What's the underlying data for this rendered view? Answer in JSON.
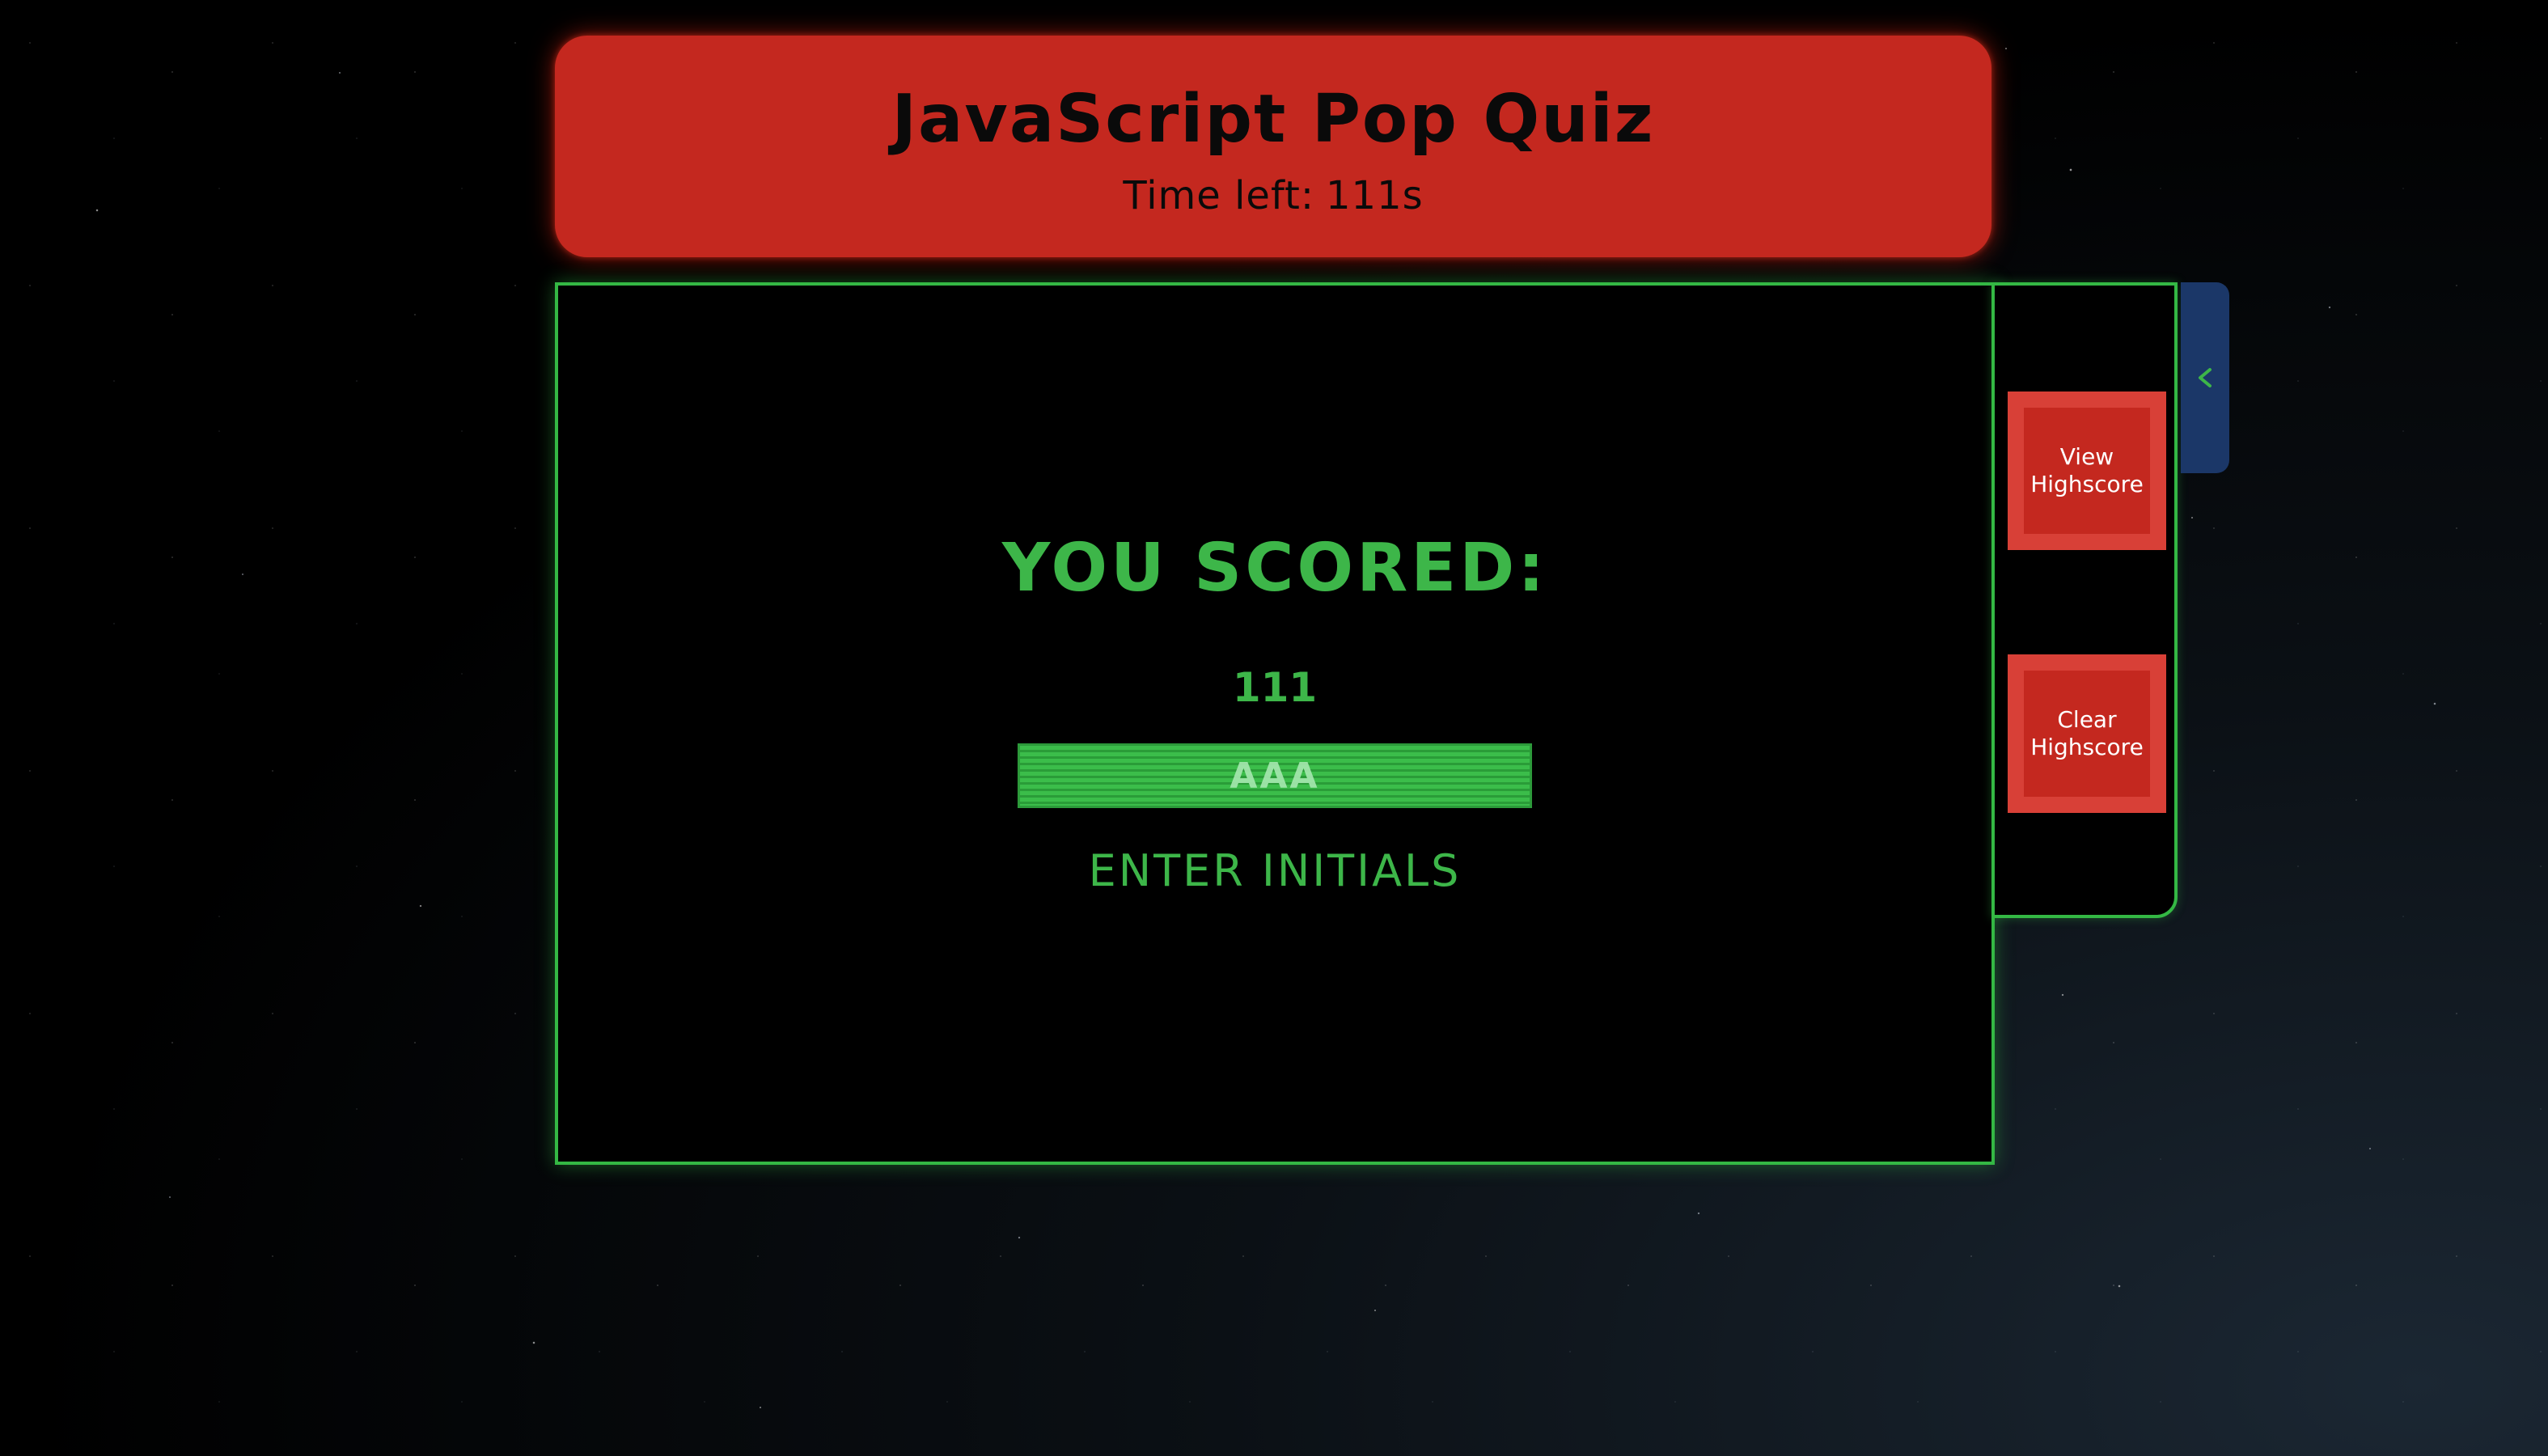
{
  "header": {
    "title": "JavaScript Pop Quiz",
    "timer_label": "Time left:",
    "timer_value": "111s"
  },
  "result": {
    "heading": "YOU SCORED:",
    "score": "111",
    "initials_placeholder": "AAA",
    "enter_label": "ENTER INITIALS"
  },
  "sidebar": {
    "view_highscore_label": "View Highscore",
    "clear_highscore_label": "Clear Highscore",
    "toggle_icon": "chevron-left-icon"
  },
  "colors": {
    "header_red": "#c4281f",
    "accent_green": "#3db649",
    "tab_blue": "#1b3768",
    "background": "#000000"
  }
}
